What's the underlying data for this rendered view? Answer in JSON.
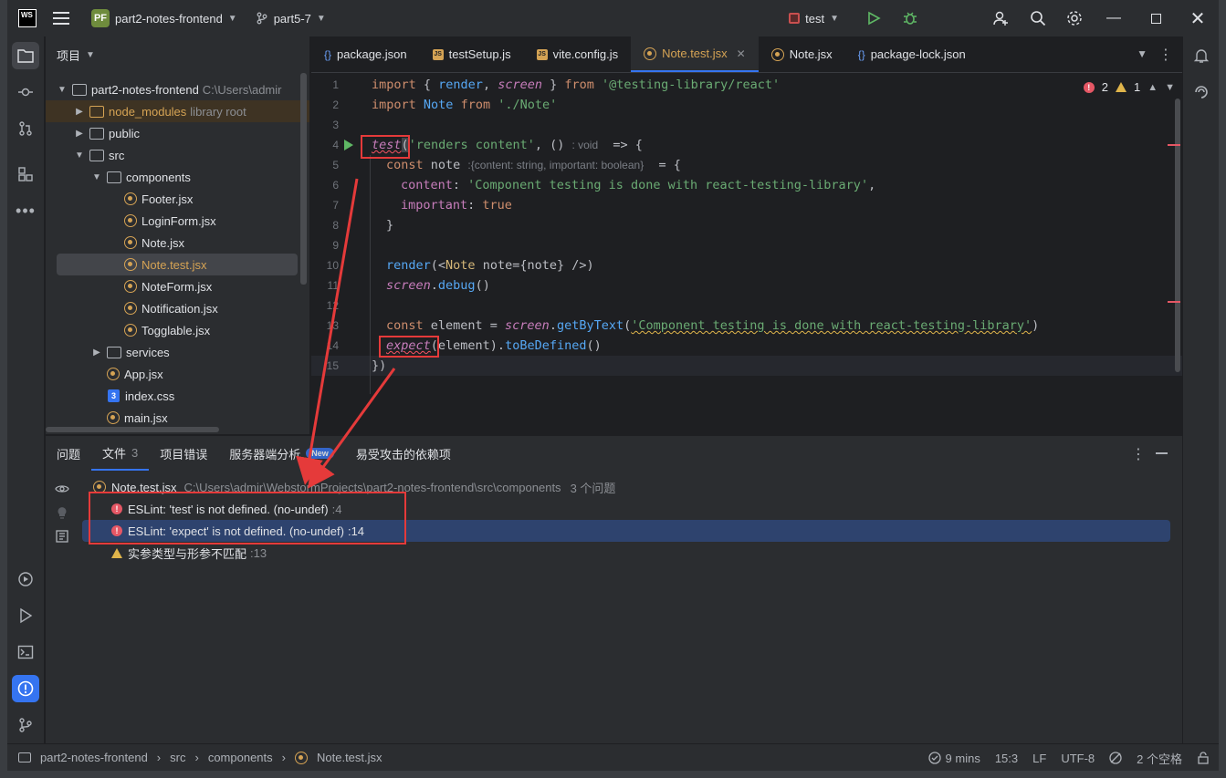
{
  "titlebar": {
    "ws_logo": "WS",
    "project_badge": "PF",
    "project_name": "part2-notes-frontend",
    "branch": "part5-7",
    "run_config": "test"
  },
  "project_panel": {
    "header": "项目",
    "tree": [
      {
        "label": "part2-notes-frontend",
        "hint": "C:\\Users\\admir"
      },
      {
        "label": "node_modules",
        "hint": "library root"
      },
      {
        "label": "public"
      },
      {
        "label": "src"
      },
      {
        "label": "components"
      },
      {
        "label": "Footer.jsx"
      },
      {
        "label": "LoginForm.jsx"
      },
      {
        "label": "Note.jsx"
      },
      {
        "label": "Note.test.jsx"
      },
      {
        "label": "NoteForm.jsx"
      },
      {
        "label": "Notification.jsx"
      },
      {
        "label": "Togglable.jsx"
      },
      {
        "label": "services"
      },
      {
        "label": "App.jsx"
      },
      {
        "label": "index.css"
      },
      {
        "label": "main.jsx"
      }
    ]
  },
  "editor": {
    "tabs": [
      {
        "label": "package.json",
        "icon": "json-icon"
      },
      {
        "label": "testSetup.js",
        "icon": "js-icon"
      },
      {
        "label": "vite.config.js",
        "icon": "js-icon"
      },
      {
        "label": "Note.test.jsx",
        "icon": "react-icon",
        "active": true
      },
      {
        "label": "Note.jsx",
        "icon": "react-icon"
      },
      {
        "label": "package-lock.json",
        "icon": "json-icon"
      }
    ],
    "error_count": "2",
    "warning_count": "1",
    "line_numbers": [
      "1",
      "2",
      "3",
      "4",
      "5",
      "6",
      "7",
      "8",
      "9",
      "10",
      "11",
      "12",
      "13",
      "14",
      "15"
    ],
    "code": {
      "l1": {
        "import": "import",
        "ob": " { ",
        "render": "render",
        "comma": ", ",
        "screen": "screen",
        "cb": " } ",
        "from": "from",
        "sp": " ",
        "str": "'@testing-library/react'"
      },
      "l2": {
        "import": "import",
        "note": " Note ",
        "from": "from",
        "sp": " ",
        "str": "'./Note'"
      },
      "l4": {
        "test": "test",
        "paren": "(",
        "str": "'renders content'",
        "rest": ", () ",
        "hint": ": void",
        "arrow": "  => {"
      },
      "l5": {
        "const": "const",
        "name": " note ",
        "hint": ":{content: string, important: boolean}",
        "eq": "  = {"
      },
      "l6": {
        "prop": "content",
        "colon": ": ",
        "str": "'Component testing is done with react-testing-library'",
        "end": ","
      },
      "l7": {
        "prop": "important",
        "colon": ": ",
        "val": "true"
      },
      "l8": {
        "brace": "}"
      },
      "l10": {
        "render": "render",
        "open": "(<",
        "tag": "Note",
        "rest": " note={note} />)"
      },
      "l11": {
        "screen": "screen",
        "dot": ".",
        "fn": "debug",
        "paren": "()"
      },
      "l13": {
        "const": "const",
        "rest": " element = ",
        "screen": "screen",
        "dot": ".",
        "fn": "getByText",
        "open": "(",
        "str": "'Component testing is done with react-testing-library'",
        "close": ")"
      },
      "l14": {
        "expect": "expect",
        "rest": "(element).",
        "fn": "toBeDefined",
        "paren": "()"
      },
      "l15": {
        "close": "})"
      }
    }
  },
  "problems": {
    "tabs": [
      {
        "label": "问题"
      },
      {
        "label": "文件",
        "count": "3",
        "active": true
      },
      {
        "label": "项目错误"
      },
      {
        "label": "服务器端分析",
        "badge": "New"
      },
      {
        "label": "易受攻击的依赖项"
      }
    ],
    "file_row": {
      "file": "Note.test.jsx",
      "path": "C:\\Users\\admir\\WebstormProjects\\part2-notes-frontend\\src\\components",
      "count": "3 个问题"
    },
    "items": [
      {
        "severity": "error",
        "text": "ESLint: 'test' is not defined. (no-undef)",
        "line": ":4"
      },
      {
        "severity": "error",
        "text": "ESLint: 'expect' is not defined. (no-undef)",
        "line": ":14",
        "selected": true
      },
      {
        "severity": "warning",
        "text": "实参类型与形参不匹配",
        "line": ":13"
      }
    ]
  },
  "statusbar": {
    "crumbs": [
      "part2-notes-frontend",
      "src",
      "components",
      "Note.test.jsx"
    ],
    "time": "9 mins",
    "position": "15:3",
    "line_sep": "LF",
    "encoding": "UTF-8",
    "indent": "2 个空格"
  },
  "colors": {
    "accent": "#3574f0",
    "error": "#e55765",
    "warning": "#e0b54b",
    "annotation": "#e53a3a"
  }
}
